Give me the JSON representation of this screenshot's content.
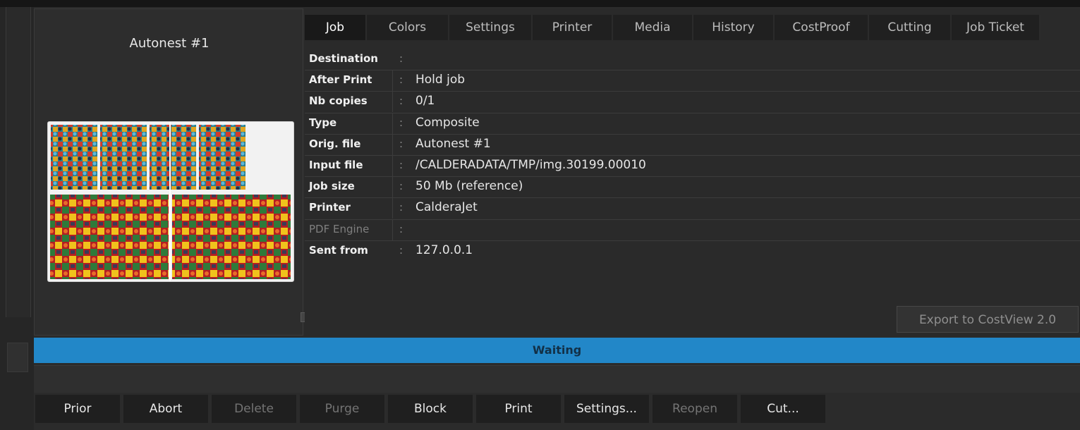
{
  "preview": {
    "title": "Autonest #1",
    "thumbnail_icon": "job-thumbnail"
  },
  "tabs": [
    {
      "label": "Job",
      "active": true
    },
    {
      "label": "Colors",
      "active": false
    },
    {
      "label": "Settings",
      "active": false
    },
    {
      "label": "Printer",
      "active": false
    },
    {
      "label": "Media",
      "active": false
    },
    {
      "label": "History",
      "active": false
    },
    {
      "label": "CostProof",
      "active": false
    },
    {
      "label": "Cutting",
      "active": false
    },
    {
      "label": "Job Ticket",
      "active": false
    }
  ],
  "job": {
    "separator": ":",
    "fields": [
      {
        "label": "Destination",
        "value": ""
      },
      {
        "label": "After Print",
        "value": "Hold job"
      },
      {
        "label": "Nb copies",
        "value": "0/1"
      },
      {
        "label": "Type",
        "value": "Composite"
      },
      {
        "label": "Orig. file",
        "value": "Autonest #1"
      },
      {
        "label": "Input file",
        "value": "/CALDERADATA/TMP/img.30199.00010"
      },
      {
        "label": "Job size",
        "value": "50 Mb (reference)"
      },
      {
        "label": "Printer",
        "value": "CalderaJet"
      },
      {
        "label": "PDF Engine",
        "value": "",
        "disabled": true
      },
      {
        "label": "Sent from",
        "value": "127.0.0.1"
      }
    ],
    "export_label": "Export to CostView 2.0"
  },
  "status": {
    "text": "Waiting",
    "color": "#2287c8"
  },
  "toolbar": [
    {
      "label": "Prior",
      "enabled": true
    },
    {
      "label": "Abort",
      "enabled": true
    },
    {
      "label": "Delete",
      "enabled": false
    },
    {
      "label": "Purge",
      "enabled": false
    },
    {
      "label": "Block",
      "enabled": true
    },
    {
      "label": "Print",
      "enabled": true
    },
    {
      "label": "Settings...",
      "enabled": true
    },
    {
      "label": "Reopen",
      "enabled": false
    },
    {
      "label": "Cut...",
      "enabled": true
    }
  ]
}
